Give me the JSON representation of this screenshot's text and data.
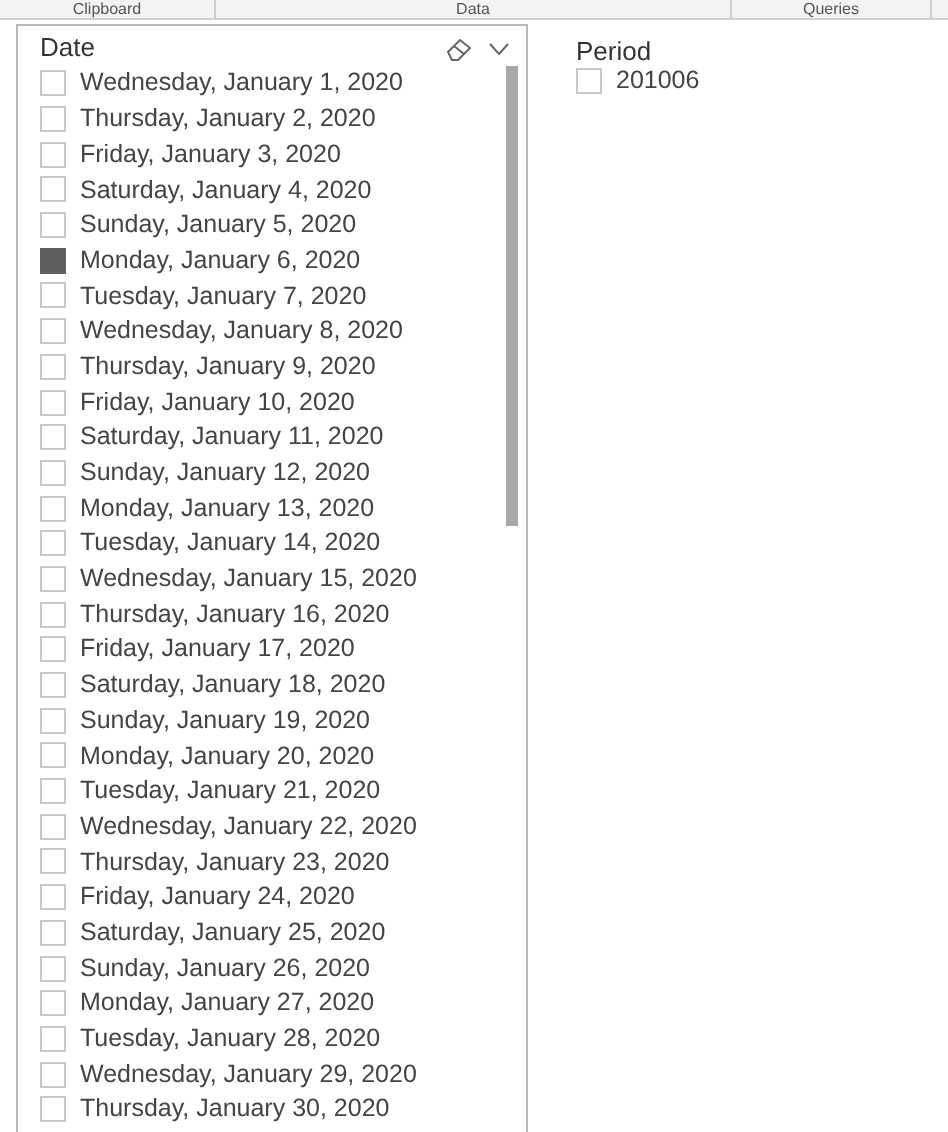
{
  "ribbon": {
    "groups": [
      "Clipboard",
      "Data",
      "Queries"
    ]
  },
  "date_slicer": {
    "title": "Date",
    "items": [
      {
        "label": "Wednesday, January 1, 2020",
        "selected": false
      },
      {
        "label": "Thursday, January 2, 2020",
        "selected": false
      },
      {
        "label": "Friday, January 3, 2020",
        "selected": false
      },
      {
        "label": "Saturday, January 4, 2020",
        "selected": false
      },
      {
        "label": "Sunday, January 5, 2020",
        "selected": false
      },
      {
        "label": "Monday, January 6, 2020",
        "selected": true
      },
      {
        "label": "Tuesday, January 7, 2020",
        "selected": false
      },
      {
        "label": "Wednesday, January 8, 2020",
        "selected": false
      },
      {
        "label": "Thursday, January 9, 2020",
        "selected": false
      },
      {
        "label": "Friday, January 10, 2020",
        "selected": false
      },
      {
        "label": "Saturday, January 11, 2020",
        "selected": false
      },
      {
        "label": "Sunday, January 12, 2020",
        "selected": false
      },
      {
        "label": "Monday, January 13, 2020",
        "selected": false
      },
      {
        "label": "Tuesday, January 14, 2020",
        "selected": false
      },
      {
        "label": "Wednesday, January 15, 2020",
        "selected": false
      },
      {
        "label": "Thursday, January 16, 2020",
        "selected": false
      },
      {
        "label": "Friday, January 17, 2020",
        "selected": false
      },
      {
        "label": "Saturday, January 18, 2020",
        "selected": false
      },
      {
        "label": "Sunday, January 19, 2020",
        "selected": false
      },
      {
        "label": "Monday, January 20, 2020",
        "selected": false
      },
      {
        "label": "Tuesday, January 21, 2020",
        "selected": false
      },
      {
        "label": "Wednesday, January 22, 2020",
        "selected": false
      },
      {
        "label": "Thursday, January 23, 2020",
        "selected": false
      },
      {
        "label": "Friday, January 24, 2020",
        "selected": false
      },
      {
        "label": "Saturday, January 25, 2020",
        "selected": false
      },
      {
        "label": "Sunday, January 26, 2020",
        "selected": false
      },
      {
        "label": "Monday, January 27, 2020",
        "selected": false
      },
      {
        "label": "Tuesday, January 28, 2020",
        "selected": false
      },
      {
        "label": "Wednesday, January 29, 2020",
        "selected": false
      },
      {
        "label": "Thursday, January 30, 2020",
        "selected": false
      }
    ]
  },
  "period_slicer": {
    "title": "Period",
    "items": [
      {
        "label": "201006",
        "selected": false
      }
    ]
  }
}
